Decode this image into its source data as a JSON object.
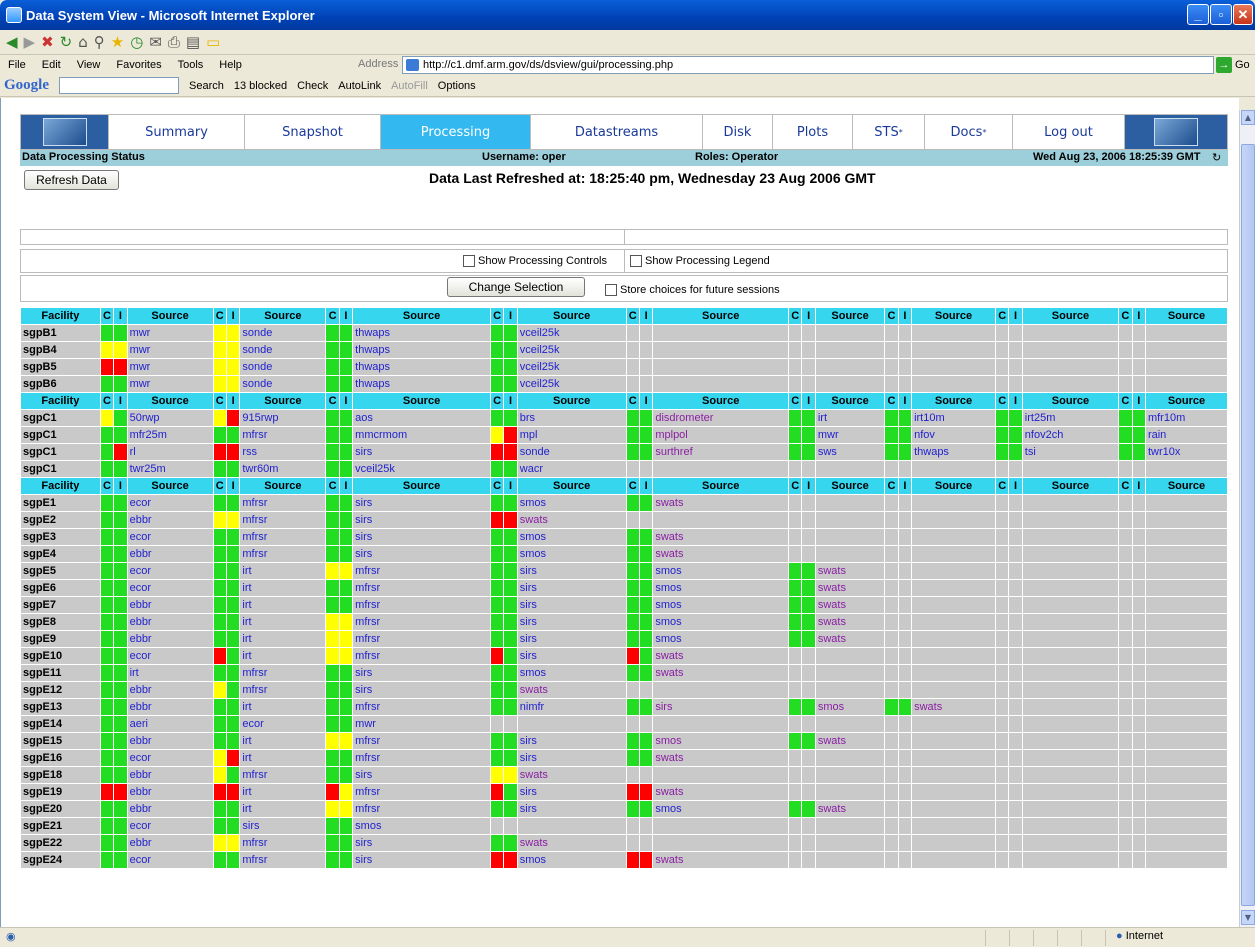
{
  "window": {
    "title": "Data System View - Microsoft Internet Explorer"
  },
  "menu": [
    "File",
    "Edit",
    "View",
    "Favorites",
    "Tools",
    "Help"
  ],
  "address": {
    "label": "Address",
    "url": "http://c1.dmf.arm.gov/ds/dsview/gui/processing.php",
    "go": "Go"
  },
  "googlebar": {
    "logo": "Google",
    "search": "Search",
    "blocked": "13 blocked",
    "check": "Check",
    "autolink": "AutoLink",
    "autofill": "AutoFill",
    "options": "Options"
  },
  "nav": {
    "tabs": [
      "Summary",
      "Snapshot",
      "Processing",
      "Datastreams",
      "Disk",
      "Plots",
      "STS",
      "Docs",
      "Log out"
    ],
    "active": "Processing"
  },
  "header": {
    "title": "Data Processing Status",
    "username": "Username: oper",
    "roles": "Roles: Operator",
    "datetime": "Wed Aug 23, 2006 18:25:39 GMT"
  },
  "refresh_label": "Refresh Data",
  "last_refreshed": "Data Last Refreshed at: 18:25:40 pm, Wednesday 23 Aug 2006 GMT",
  "options": {
    "show_controls": "Show Processing Controls",
    "show_legend": "Show Processing Legend",
    "change_selection": "Change Selection",
    "store_choices": "Store choices for future sessions"
  },
  "colors": {
    "green": "#22dd22",
    "yellow": "#ffff00",
    "red": "#ff0000",
    "header": "#35d6ee",
    "active_tab": "#33b9f0"
  },
  "columns": {
    "facility": "Facility",
    "c": "C",
    "i": "I",
    "source": "Source"
  },
  "groups": [
    {
      "rows": [
        {
          "facility": "sgpB1",
          "cells": [
            [
              "g",
              "g",
              "mwr"
            ],
            [
              "y",
              "y",
              "sonde"
            ],
            [
              "g",
              "g",
              "thwaps"
            ],
            [
              "g",
              "g",
              "vceil25k"
            ]
          ]
        },
        {
          "facility": "sgpB4",
          "cells": [
            [
              "y",
              "y",
              "mwr"
            ],
            [
              "y",
              "y",
              "sonde"
            ],
            [
              "g",
              "g",
              "thwaps"
            ],
            [
              "g",
              "g",
              "vceil25k"
            ]
          ]
        },
        {
          "facility": "sgpB5",
          "cells": [
            [
              "r",
              "r",
              "mwr"
            ],
            [
              "y",
              "y",
              "sonde"
            ],
            [
              "g",
              "g",
              "thwaps"
            ],
            [
              "g",
              "g",
              "vceil25k"
            ]
          ]
        },
        {
          "facility": "sgpB6",
          "cells": [
            [
              "g",
              "g",
              "mwr"
            ],
            [
              "y",
              "y",
              "sonde"
            ],
            [
              "g",
              "g",
              "thwaps"
            ],
            [
              "g",
              "g",
              "vceil25k"
            ]
          ]
        }
      ]
    },
    {
      "rows": [
        {
          "facility": "sgpC1",
          "cells": [
            [
              "y",
              "g",
              "50rwp"
            ],
            [
              "y",
              "r",
              "915rwp"
            ],
            [
              "g",
              "g",
              "aos"
            ],
            [
              "g",
              "g",
              "brs"
            ],
            [
              "g",
              "g",
              "disdrometer",
              1
            ],
            [
              "g",
              "g",
              "irt"
            ],
            [
              "g",
              "g",
              "irt10m"
            ],
            [
              "g",
              "g",
              "irt25m"
            ],
            [
              "g",
              "g",
              "mfr10m"
            ]
          ]
        },
        {
          "facility": "sgpC1",
          "cells": [
            [
              "g",
              "g",
              "mfr25m"
            ],
            [
              "g",
              "g",
              "mfrsr"
            ],
            [
              "g",
              "g",
              "mmcrmom"
            ],
            [
              "y",
              "r",
              "mpl"
            ],
            [
              "g",
              "g",
              "mplpol",
              1
            ],
            [
              "g",
              "g",
              "mwr"
            ],
            [
              "g",
              "g",
              "nfov"
            ],
            [
              "g",
              "g",
              "nfov2ch"
            ],
            [
              "g",
              "g",
              "rain"
            ]
          ]
        },
        {
          "facility": "sgpC1",
          "cells": [
            [
              "g",
              "r",
              "rl"
            ],
            [
              "r",
              "r",
              "rss"
            ],
            [
              "g",
              "g",
              "sirs"
            ],
            [
              "r",
              "r",
              "sonde"
            ],
            [
              "g",
              "g",
              "surthref",
              1
            ],
            [
              "g",
              "g",
              "sws"
            ],
            [
              "g",
              "g",
              "thwaps"
            ],
            [
              "g",
              "g",
              "tsi"
            ],
            [
              "g",
              "g",
              "twr10x"
            ]
          ]
        },
        {
          "facility": "sgpC1",
          "cells": [
            [
              "g",
              "g",
              "twr25m"
            ],
            [
              "g",
              "g",
              "twr60m"
            ],
            [
              "g",
              "g",
              "vceil25k"
            ],
            [
              "g",
              "g",
              "wacr"
            ]
          ]
        }
      ]
    },
    {
      "rows": [
        {
          "facility": "sgpE1",
          "cells": [
            [
              "g",
              "g",
              "ecor"
            ],
            [
              "g",
              "g",
              "mfrsr"
            ],
            [
              "g",
              "g",
              "sirs"
            ],
            [
              "g",
              "g",
              "smos"
            ],
            [
              "g",
              "g",
              "swats",
              1
            ]
          ]
        },
        {
          "facility": "sgpE2",
          "cells": [
            [
              "g",
              "g",
              "ebbr"
            ],
            [
              "y",
              "y",
              "mfrsr"
            ],
            [
              "g",
              "g",
              "sirs"
            ],
            [
              "r",
              "r",
              "swats",
              1
            ]
          ]
        },
        {
          "facility": "sgpE3",
          "cells": [
            [
              "g",
              "g",
              "ecor"
            ],
            [
              "g",
              "g",
              "mfrsr"
            ],
            [
              "g",
              "g",
              "sirs"
            ],
            [
              "g",
              "g",
              "smos"
            ],
            [
              "g",
              "g",
              "swats",
              1
            ]
          ]
        },
        {
          "facility": "sgpE4",
          "cells": [
            [
              "g",
              "g",
              "ebbr"
            ],
            [
              "g",
              "g",
              "mfrsr"
            ],
            [
              "g",
              "g",
              "sirs"
            ],
            [
              "g",
              "g",
              "smos"
            ],
            [
              "g",
              "g",
              "swats",
              1
            ]
          ]
        },
        {
          "facility": "sgpE5",
          "cells": [
            [
              "g",
              "g",
              "ecor"
            ],
            [
              "g",
              "g",
              "irt"
            ],
            [
              "y",
              "y",
              "mfrsr"
            ],
            [
              "g",
              "g",
              "sirs"
            ],
            [
              "g",
              "g",
              "smos"
            ],
            [
              "g",
              "g",
              "swats",
              1
            ]
          ]
        },
        {
          "facility": "sgpE6",
          "cells": [
            [
              "g",
              "g",
              "ecor"
            ],
            [
              "g",
              "g",
              "irt"
            ],
            [
              "g",
              "g",
              "mfrsr"
            ],
            [
              "g",
              "g",
              "sirs"
            ],
            [
              "g",
              "g",
              "smos"
            ],
            [
              "g",
              "g",
              "swats",
              1
            ]
          ]
        },
        {
          "facility": "sgpE7",
          "cells": [
            [
              "g",
              "g",
              "ebbr"
            ],
            [
              "g",
              "g",
              "irt"
            ],
            [
              "g",
              "g",
              "mfrsr"
            ],
            [
              "g",
              "g",
              "sirs"
            ],
            [
              "g",
              "g",
              "smos"
            ],
            [
              "g",
              "g",
              "swats",
              1
            ]
          ]
        },
        {
          "facility": "sgpE8",
          "cells": [
            [
              "g",
              "g",
              "ebbr"
            ],
            [
              "g",
              "g",
              "irt"
            ],
            [
              "y",
              "y",
              "mfrsr"
            ],
            [
              "g",
              "g",
              "sirs"
            ],
            [
              "g",
              "g",
              "smos"
            ],
            [
              "g",
              "g",
              "swats",
              1
            ]
          ]
        },
        {
          "facility": "sgpE9",
          "cells": [
            [
              "g",
              "g",
              "ebbr"
            ],
            [
              "g",
              "g",
              "irt"
            ],
            [
              "y",
              "y",
              "mfrsr"
            ],
            [
              "g",
              "g",
              "sirs"
            ],
            [
              "g",
              "g",
              "smos"
            ],
            [
              "g",
              "g",
              "swats",
              1
            ]
          ]
        },
        {
          "facility": "sgpE10",
          "cells": [
            [
              "g",
              "g",
              "ecor"
            ],
            [
              "r",
              "g",
              "irt"
            ],
            [
              "y",
              "y",
              "mfrsr"
            ],
            [
              "r",
              "g",
              "sirs"
            ],
            [
              "r",
              "g",
              "swats",
              1
            ]
          ]
        },
        {
          "facility": "sgpE11",
          "cells": [
            [
              "g",
              "g",
              "irt"
            ],
            [
              "g",
              "g",
              "mfrsr"
            ],
            [
              "g",
              "g",
              "sirs"
            ],
            [
              "g",
              "g",
              "smos"
            ],
            [
              "g",
              "g",
              "swats",
              1
            ]
          ]
        },
        {
          "facility": "sgpE12",
          "cells": [
            [
              "g",
              "g",
              "ebbr"
            ],
            [
              "y",
              "g",
              "mfrsr"
            ],
            [
              "g",
              "g",
              "sirs"
            ],
            [
              "g",
              "g",
              "swats",
              1
            ]
          ]
        },
        {
          "facility": "sgpE13",
          "cells": [
            [
              "g",
              "g",
              "ebbr"
            ],
            [
              "g",
              "g",
              "irt"
            ],
            [
              "g",
              "g",
              "mfrsr"
            ],
            [
              "g",
              "g",
              "nimfr"
            ],
            [
              "g",
              "g",
              "sirs",
              1
            ],
            [
              "g",
              "g",
              "smos",
              1
            ],
            [
              "g",
              "g",
              "swats",
              1
            ]
          ]
        },
        {
          "facility": "sgpE14",
          "cells": [
            [
              "g",
              "g",
              "aeri"
            ],
            [
              "g",
              "g",
              "ecor"
            ],
            [
              "g",
              "g",
              "mwr"
            ]
          ]
        },
        {
          "facility": "sgpE15",
          "cells": [
            [
              "g",
              "g",
              "ebbr"
            ],
            [
              "g",
              "g",
              "irt"
            ],
            [
              "y",
              "y",
              "mfrsr"
            ],
            [
              "g",
              "g",
              "sirs"
            ],
            [
              "g",
              "g",
              "smos",
              1
            ],
            [
              "g",
              "g",
              "swats",
              1
            ]
          ]
        },
        {
          "facility": "sgpE16",
          "cells": [
            [
              "g",
              "g",
              "ecor"
            ],
            [
              "y",
              "r",
              "irt"
            ],
            [
              "g",
              "g",
              "mfrsr"
            ],
            [
              "g",
              "g",
              "sirs"
            ],
            [
              "g",
              "g",
              "swats",
              1
            ]
          ]
        },
        {
          "facility": "sgpE18",
          "cells": [
            [
              "g",
              "g",
              "ebbr"
            ],
            [
              "y",
              "g",
              "mfrsr"
            ],
            [
              "g",
              "g",
              "sirs"
            ],
            [
              "y",
              "y",
              "swats",
              1
            ]
          ]
        },
        {
          "facility": "sgpE19",
          "cells": [
            [
              "r",
              "r",
              "ebbr"
            ],
            [
              "r",
              "r",
              "irt"
            ],
            [
              "r",
              "y",
              "mfrsr"
            ],
            [
              "r",
              "g",
              "sirs"
            ],
            [
              "r",
              "r",
              "swats",
              1
            ]
          ]
        },
        {
          "facility": "sgpE20",
          "cells": [
            [
              "g",
              "g",
              "ebbr"
            ],
            [
              "g",
              "g",
              "irt"
            ],
            [
              "y",
              "y",
              "mfrsr"
            ],
            [
              "g",
              "g",
              "sirs"
            ],
            [
              "g",
              "g",
              "smos"
            ],
            [
              "g",
              "g",
              "swats",
              1
            ]
          ]
        },
        {
          "facility": "sgpE21",
          "cells": [
            [
              "g",
              "g",
              "ecor"
            ],
            [
              "g",
              "g",
              "sirs"
            ],
            [
              "g",
              "g",
              "smos"
            ]
          ]
        },
        {
          "facility": "sgpE22",
          "cells": [
            [
              "g",
              "g",
              "ebbr"
            ],
            [
              "y",
              "y",
              "mfrsr"
            ],
            [
              "g",
              "g",
              "sirs"
            ],
            [
              "g",
              "g",
              "swats",
              1
            ]
          ]
        },
        {
          "facility": "sgpE24",
          "cells": [
            [
              "g",
              "g",
              "ecor"
            ],
            [
              "g",
              "g",
              "mfrsr"
            ],
            [
              "g",
              "g",
              "sirs"
            ],
            [
              "r",
              "r",
              "smos"
            ],
            [
              "r",
              "r",
              "swats",
              1
            ]
          ]
        }
      ]
    }
  ],
  "status": {
    "zone": "Internet"
  }
}
